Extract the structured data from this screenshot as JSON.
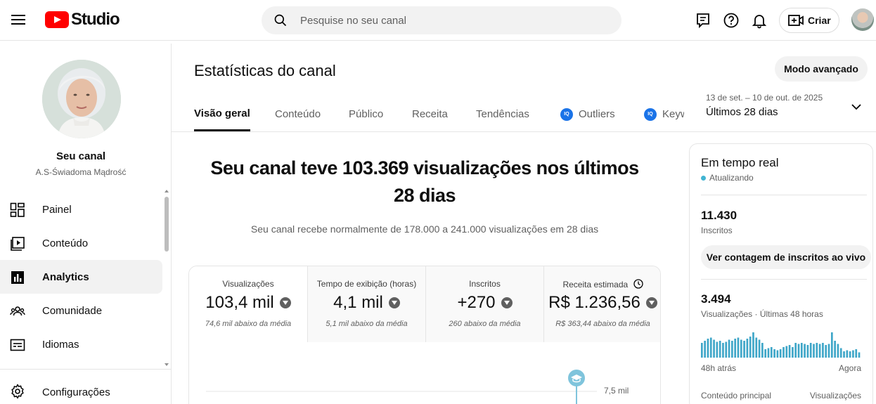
{
  "app": {
    "logo_text": "Studio",
    "brand_color": "#ff0000"
  },
  "search": {
    "placeholder": "Pesquise no seu canal"
  },
  "header": {
    "create_label": "Criar"
  },
  "sidebar": {
    "channel_name": "Seu canal",
    "channel_handle": "A.S-Świadoma Mądrość",
    "items": [
      {
        "label": "Painel",
        "icon": "dashboard-icon",
        "active": false
      },
      {
        "label": "Conteúdo",
        "icon": "content-icon",
        "active": false
      },
      {
        "label": "Analytics",
        "icon": "analytics-icon",
        "active": true
      },
      {
        "label": "Comunidade",
        "icon": "community-icon",
        "active": false
      },
      {
        "label": "Idiomas",
        "icon": "subtitles-icon",
        "active": false
      }
    ],
    "settings_label": "Configurações"
  },
  "main": {
    "title": "Estatísticas do canal",
    "advanced_button": "Modo avançado",
    "tabs": [
      {
        "label": "Visão geral",
        "active": true
      },
      {
        "label": "Conteúdo",
        "active": false
      },
      {
        "label": "Público",
        "active": false
      },
      {
        "label": "Receita",
        "active": false
      },
      {
        "label": "Tendências",
        "active": false
      },
      {
        "label": "Outliers",
        "badge": "IQ",
        "active": false
      },
      {
        "label": "Keyw",
        "badge": "IQ",
        "active": false
      }
    ],
    "date_range": "13 de set. – 10 de out. de 2025",
    "date_label": "Últimos 28 dias",
    "headline": "Seu canal teve 103.369 visualizações nos últimos 28 dias",
    "subline": "Seu canal recebe normalmente de 178.000 a 241.000 visualizações em 28 dias"
  },
  "metrics": [
    {
      "label": "Visualizações",
      "value": "103,4 mil",
      "note": "74,6 mil abaixo da média",
      "trend": "down"
    },
    {
      "label": "Tempo de exibição (horas)",
      "value": "4,1 mil",
      "note": "5,1 mil abaixo da média",
      "trend": "down"
    },
    {
      "label": "Inscritos",
      "value": "+270",
      "note": "260 abaixo da média",
      "trend": "down"
    },
    {
      "label": "Receita estimada",
      "value": "R$ 1.236,56",
      "note": "R$ 363,44 abaixo da média",
      "trend": "down"
    }
  ],
  "chart": {
    "y_tick": "7,5 mil",
    "accent": "#7fc4dc"
  },
  "realtime": {
    "title": "Em tempo real",
    "status": "Atualizando",
    "subscribers_value": "11.430",
    "subscribers_label": "Inscritos",
    "live_button": "Ver contagem de inscritos ao vivo",
    "views_value": "3.494",
    "views_label": "Visualizações · Últimas 48 horas",
    "axis_left": "48h atrás",
    "axis_right": "Agora",
    "col_left": "Conteúdo principal",
    "col_right": "Visualizações",
    "bar_color": "#3ea6c8",
    "bars": [
      14,
      16,
      18,
      19,
      17,
      15,
      16,
      14,
      15,
      17,
      16,
      18,
      19,
      17,
      16,
      18,
      20,
      24,
      19,
      17,
      14,
      8,
      9,
      10,
      8,
      7,
      8,
      10,
      11,
      12,
      10,
      14,
      13,
      14,
      13,
      12,
      14,
      13,
      14,
      13,
      14,
      12,
      13,
      24,
      16,
      13,
      9,
      6,
      7,
      6,
      7,
      8,
      5
    ]
  }
}
